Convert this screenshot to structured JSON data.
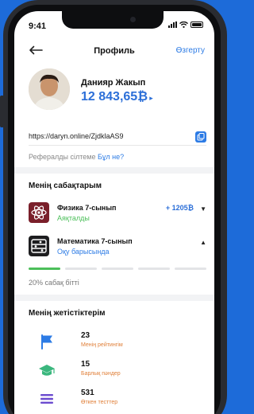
{
  "status": {
    "time": "9:41"
  },
  "header": {
    "title": "Профиль",
    "edit_label": "Өзгерту",
    "back_icon": "arrow-left-icon"
  },
  "profile": {
    "name": "Данияр Жакып",
    "balance": "12 843,65₿",
    "balance_arrow": "▸"
  },
  "referral": {
    "link": "https://daryn.online/ZjdklaAS9",
    "label": "Рефералды сілтеме",
    "help_link": "Бұл не?"
  },
  "courses_section": {
    "title": "Менің сабақтарым",
    "items": [
      {
        "title": "Физика 7-сынып",
        "status": "Аяқталды",
        "status_color": "#4cbf5a",
        "reward": "+ 1205₿",
        "chevron": "▼"
      },
      {
        "title": "Математика 7-сынып",
        "status": "Оқу барысында",
        "status_color": "#2c7be5",
        "reward": "",
        "chevron": "▲"
      }
    ],
    "progress_text": "20% сабақ бітті",
    "progress_fraction": 0.2
  },
  "achievements_section": {
    "title": "Менің жетістіктерім",
    "items": [
      {
        "value": "23",
        "label": "Менің рейтингім",
        "icon": "flag-icon"
      },
      {
        "value": "15",
        "label": "Барлық пәндер",
        "icon": "graduation-cap-icon"
      },
      {
        "value": "531",
        "label": "Өткен тесттер",
        "icon": "list-icon"
      }
    ]
  },
  "colors": {
    "accent": "#2c7be5",
    "success": "#4cbf5a",
    "label_orange": "#e0803a",
    "background": "#1d6bd9"
  }
}
